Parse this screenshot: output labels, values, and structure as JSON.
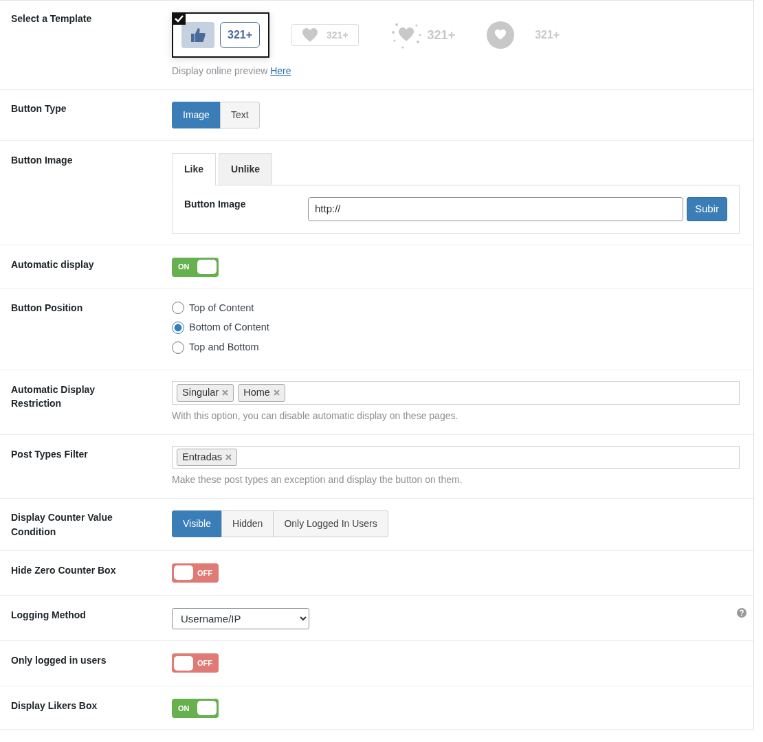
{
  "rows": [
    {
      "kind": "template",
      "label": "Select a Template",
      "templates": [
        {
          "kind": "thumb_bubble",
          "count": "321+",
          "selected": true
        },
        {
          "kind": "heart_box",
          "count": "321+",
          "selected": false
        },
        {
          "kind": "heart_burst",
          "count": "321+",
          "selected": false
        },
        {
          "kind": "heart_circle",
          "count": "321+",
          "selected": false
        }
      ],
      "help": "Display online preview",
      "link": "Here"
    },
    {
      "kind": "segmented",
      "label": "Button Type",
      "options": [
        {
          "label": "Image",
          "selected": true
        },
        {
          "label": "Text",
          "selected": false
        }
      ]
    },
    {
      "kind": "image_tabs",
      "label": "Button Image",
      "tabs": [
        {
          "label": "Like",
          "selected": true
        },
        {
          "label": "Unlike",
          "selected": false
        }
      ],
      "field_label": "Button Image",
      "value": "http://",
      "button": "Subir"
    },
    {
      "kind": "toggle",
      "label": "Automatic display",
      "on": true,
      "text": "ON"
    },
    {
      "kind": "radios",
      "label": "Button Position",
      "options": [
        {
          "label": "Top of Content",
          "selected": false
        },
        {
          "label": "Bottom of Content",
          "selected": true
        },
        {
          "label": "Top and Bottom",
          "selected": false
        }
      ]
    },
    {
      "kind": "tags",
      "label": "Automatic Display Restriction",
      "tags": [
        "Singular",
        "Home"
      ],
      "help": "With this option, you can disable automatic display on these pages."
    },
    {
      "kind": "tags",
      "label": "Post Types Filter",
      "tags": [
        "Entradas"
      ],
      "help": "Make these post types an exception and display the button on them."
    },
    {
      "kind": "segmented",
      "label": "Display Counter Value Condition",
      "options": [
        {
          "label": "Visible",
          "selected": true
        },
        {
          "label": "Hidden",
          "selected": false
        },
        {
          "label": "Only Logged In Users",
          "selected": false
        }
      ]
    },
    {
      "kind": "toggle",
      "label": "Hide Zero Counter Box",
      "on": false,
      "text": "OFF"
    },
    {
      "kind": "select",
      "label": "Logging Method",
      "value": "Username/IP"
    },
    {
      "kind": "toggle",
      "label": "Only logged in users",
      "on": false,
      "text": "OFF"
    },
    {
      "kind": "toggle",
      "label": "Display Likers Box",
      "on": true,
      "text": "ON"
    }
  ]
}
